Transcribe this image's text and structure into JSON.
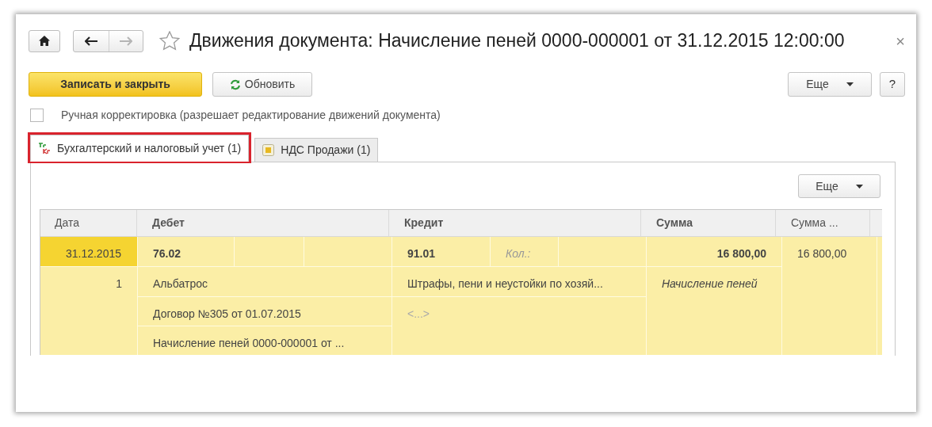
{
  "window": {
    "title": "Движения документа: Начисление пеней 0000-000001 от 31.12.2015 12:00:00",
    "close": "×"
  },
  "nav": {
    "forward_disabled": true
  },
  "toolbar": {
    "primary_button": "Записать и закрыть",
    "refresh_button": "Обновить",
    "more_button": "Еще",
    "help_button": "?"
  },
  "manual_edit": {
    "label": "Ручная корректировка (разрешает редактирование движений документа)",
    "checked": false
  },
  "tabs": [
    {
      "label": "Бухгалтерский и налоговый учет (1)",
      "selected": true,
      "highlighted": true,
      "kind": "ledger"
    },
    {
      "label": "НДС Продажи (1)",
      "selected": false,
      "highlighted": false,
      "kind": "register"
    }
  ],
  "panel": {
    "more_button": "Еще"
  },
  "table": {
    "columns": [
      {
        "label": "Дата"
      },
      {
        "label": "Дебет"
      },
      {
        "label": "Кредит"
      },
      {
        "label": "Сумма"
      },
      {
        "label": "Сумма ..."
      }
    ],
    "rows": [
      {
        "selected": true,
        "date": "31.12.2015",
        "line_number": "1",
        "debit": {
          "account": "76.02",
          "subconto": [
            "Альбатрос",
            "Договор №305 от 01.07.2015",
            "Начисление пеней 0000-000001 от ..."
          ]
        },
        "credit": {
          "account": "91.01",
          "quantity_label": "Кол.:",
          "subconto": [
            "Штрафы, пени и неустойки по хозяй...",
            "<...>"
          ]
        },
        "amount": "16 800,00",
        "content": "Начисление пеней",
        "column_5": "16 800,00"
      }
    ]
  }
}
